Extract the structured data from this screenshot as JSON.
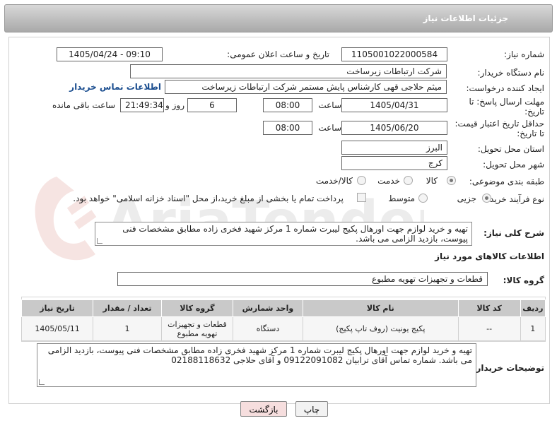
{
  "header": {
    "title": "جزئیات اطلاعات نیاز"
  },
  "fields": {
    "need_number_label": "شماره نیاز:",
    "need_number": "1105001022000584",
    "announce_label": "تاریخ و ساعت اعلان عمومی:",
    "announce_value": "1405/04/24 - 09:10",
    "buyer_org_label": "نام دستگاه خریدار:",
    "buyer_org": "شرکت ارتباطات زیرساخت",
    "creator_label": "ایجاد کننده درخواست:",
    "creator": "میثم حلاجی قهی کارشناس پایش مستمر شرکت ارتباطات زیرساخت",
    "contact_link": "اطلاعات تماس خریدار",
    "deadline_label_1": "مهلت ارسال پاسخ: تا",
    "deadline_label_2": "تاریخ:",
    "deadline_date": "1405/04/31",
    "time_label": "ساعت",
    "deadline_time": "08:00",
    "days": "6",
    "days_label": "روز و",
    "remaining_time": "21:49:34",
    "remaining_label": "ساعت باقی مانده",
    "price_label_1": "حداقل تاریخ اعتبار قیمت:",
    "price_label_2": "تا تاریخ:",
    "price_date": "1405/06/20",
    "price_time": "08:00",
    "province_label": "استان محل تحویل:",
    "province": "البرز",
    "city_label": "شهر محل تحویل:",
    "city": "کرج",
    "category_label": "طبقه بندی موضوعی:",
    "cat_goods": "کالا",
    "cat_service": "خدمت",
    "cat_both": "کالا/خدمت",
    "process_label": "نوع فرآیند خرید :",
    "proc_minor": "جزیی",
    "proc_medium": "متوسط",
    "payment_note": "پرداخت تمام یا بخشی از مبلغ خرید،از محل \"اسناد خزانه اسلامی\" خواهد بود.",
    "summary_label": "شرح کلی نیاز:",
    "summary": "تهیه و خرید لوازم جهت اورهال پکیج لیبرت شماره 1 مرکز شهید فخری زاده مطابق مشخصات فنی پیوست، بازدید الزامی می باشد.",
    "goods_info_label": "اطلاعات کالاهای مورد نیاز",
    "goods_group_label": "گروه کالا:",
    "goods_group": "قطعات و تجهیزات تهویه مطبوع",
    "buyer_notes_label": "توضیحات خریدار:",
    "buyer_notes": "تهیه و خرید لوازم جهت اورهال پکیج لیبرت شماره 1 مرکز شهید فخری زاده مطابق مشخصات فنی پیوست، بازدید الزامی می باشد. شماره تماس آقای ترابیان 09122091082  و آقای حلاجی 02188118632"
  },
  "table": {
    "headers": [
      "ردیف",
      "کد کالا",
      "نام کالا",
      "واحد شمارش",
      "گروه کالا",
      "تعداد / مقدار",
      "تاریخ نیاز"
    ],
    "rows": [
      [
        "1",
        "--",
        "پکیج یونیت (روف تاپ پکیج)",
        "دستگاه",
        "قطعات و تجهیزات تهویه مطبوع",
        "1",
        "1405/05/11"
      ]
    ]
  },
  "buttons": {
    "print": "چاپ",
    "back": "بازگشت"
  },
  "watermark": {
    "text": "AriaTender.net"
  },
  "colors": {
    "link": "#1a4d8f",
    "header_bg": "#b5b5b5",
    "back_btn": "#f6dede"
  }
}
